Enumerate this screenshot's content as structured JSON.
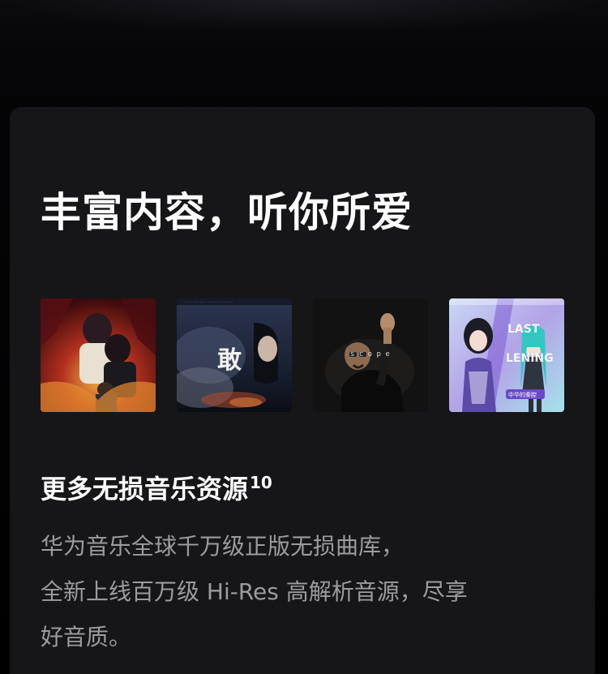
{
  "section": {
    "title": "丰富内容，听你所爱",
    "covers": [
      {
        "name": "album-cover-1",
        "alt": "两位男性插画专辑封面"
      },
      {
        "name": "album-cover-2",
        "alt": "",
        "text": "敢"
      },
      {
        "name": "album-cover-3",
        "alt": ""
      },
      {
        "name": "album-cover-4",
        "alt": "",
        "text": "中华的秦腔"
      }
    ],
    "subtitle": "更多无损音乐资源",
    "subtitle_sup": "10",
    "description_lines": [
      "华为音乐全球千万级正版无损曲库，",
      "全新上线百万级 Hi-Res 高解析音源，尽享",
      "好音质。"
    ]
  },
  "colors": {
    "card_bg": "#161618",
    "title": "#ffffff",
    "body_text": "#9c9ca0"
  }
}
